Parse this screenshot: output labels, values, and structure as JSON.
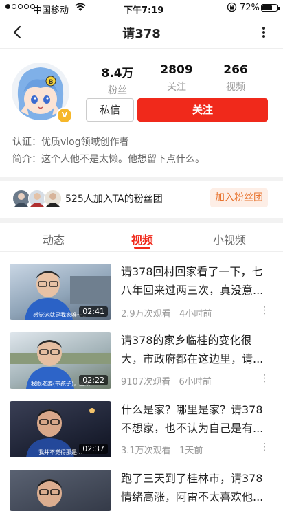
{
  "status_bar": {
    "carrier": "中国移动",
    "time": "下午7:19",
    "battery_text": "72%",
    "battery_level": 0.72
  },
  "nav": {
    "title": "请378",
    "back_icon": "chevron-left-icon",
    "more_icon": "vertical-dots-icon"
  },
  "profile": {
    "stats": [
      {
        "value": "8.4万",
        "label": "粉丝"
      },
      {
        "value": "2809",
        "label": "关注"
      },
      {
        "value": "266",
        "label": "视频"
      }
    ],
    "message_button": "私信",
    "follow_button": "关注",
    "verification_label": "认证：",
    "verification_text": "优质vlog领域创作者",
    "intro_label": "简介：",
    "intro_text": "这个人他不是太懒。他想留下点什么。",
    "badge": "V"
  },
  "fan_club": {
    "text": "525人加入TA的粉丝团",
    "button": "加入粉丝团"
  },
  "tabs": [
    "动态",
    "视频",
    "小视频"
  ],
  "active_tab": "视频",
  "videos": [
    {
      "title": "请378回村回家看了一下，七八年回来过两三次，真没意...",
      "views": "2.9万次观看",
      "time": "4小时前",
      "duration": "02:41",
      "caption": "感觉这就是我家唯一…"
    },
    {
      "title": "请378的家乡临桂的变化很大，市政府都在这边里，请...",
      "views": "9107次观看",
      "time": "6小时前",
      "duration": "02:22",
      "caption": "我跟老婆(带孩子)，回来"
    },
    {
      "title": "什么是家？哪里是家？请378不想家，也不认为自己是有...",
      "views": "3.1万次观看",
      "time": "1天前",
      "duration": "02:37",
      "caption": "我并不觉得那是…"
    },
    {
      "title": "跑了三天到了桂林市，请378情绪高涨，阿雷不太喜欢他...",
      "views": "",
      "time": "",
      "duration": "",
      "caption": ""
    }
  ]
}
